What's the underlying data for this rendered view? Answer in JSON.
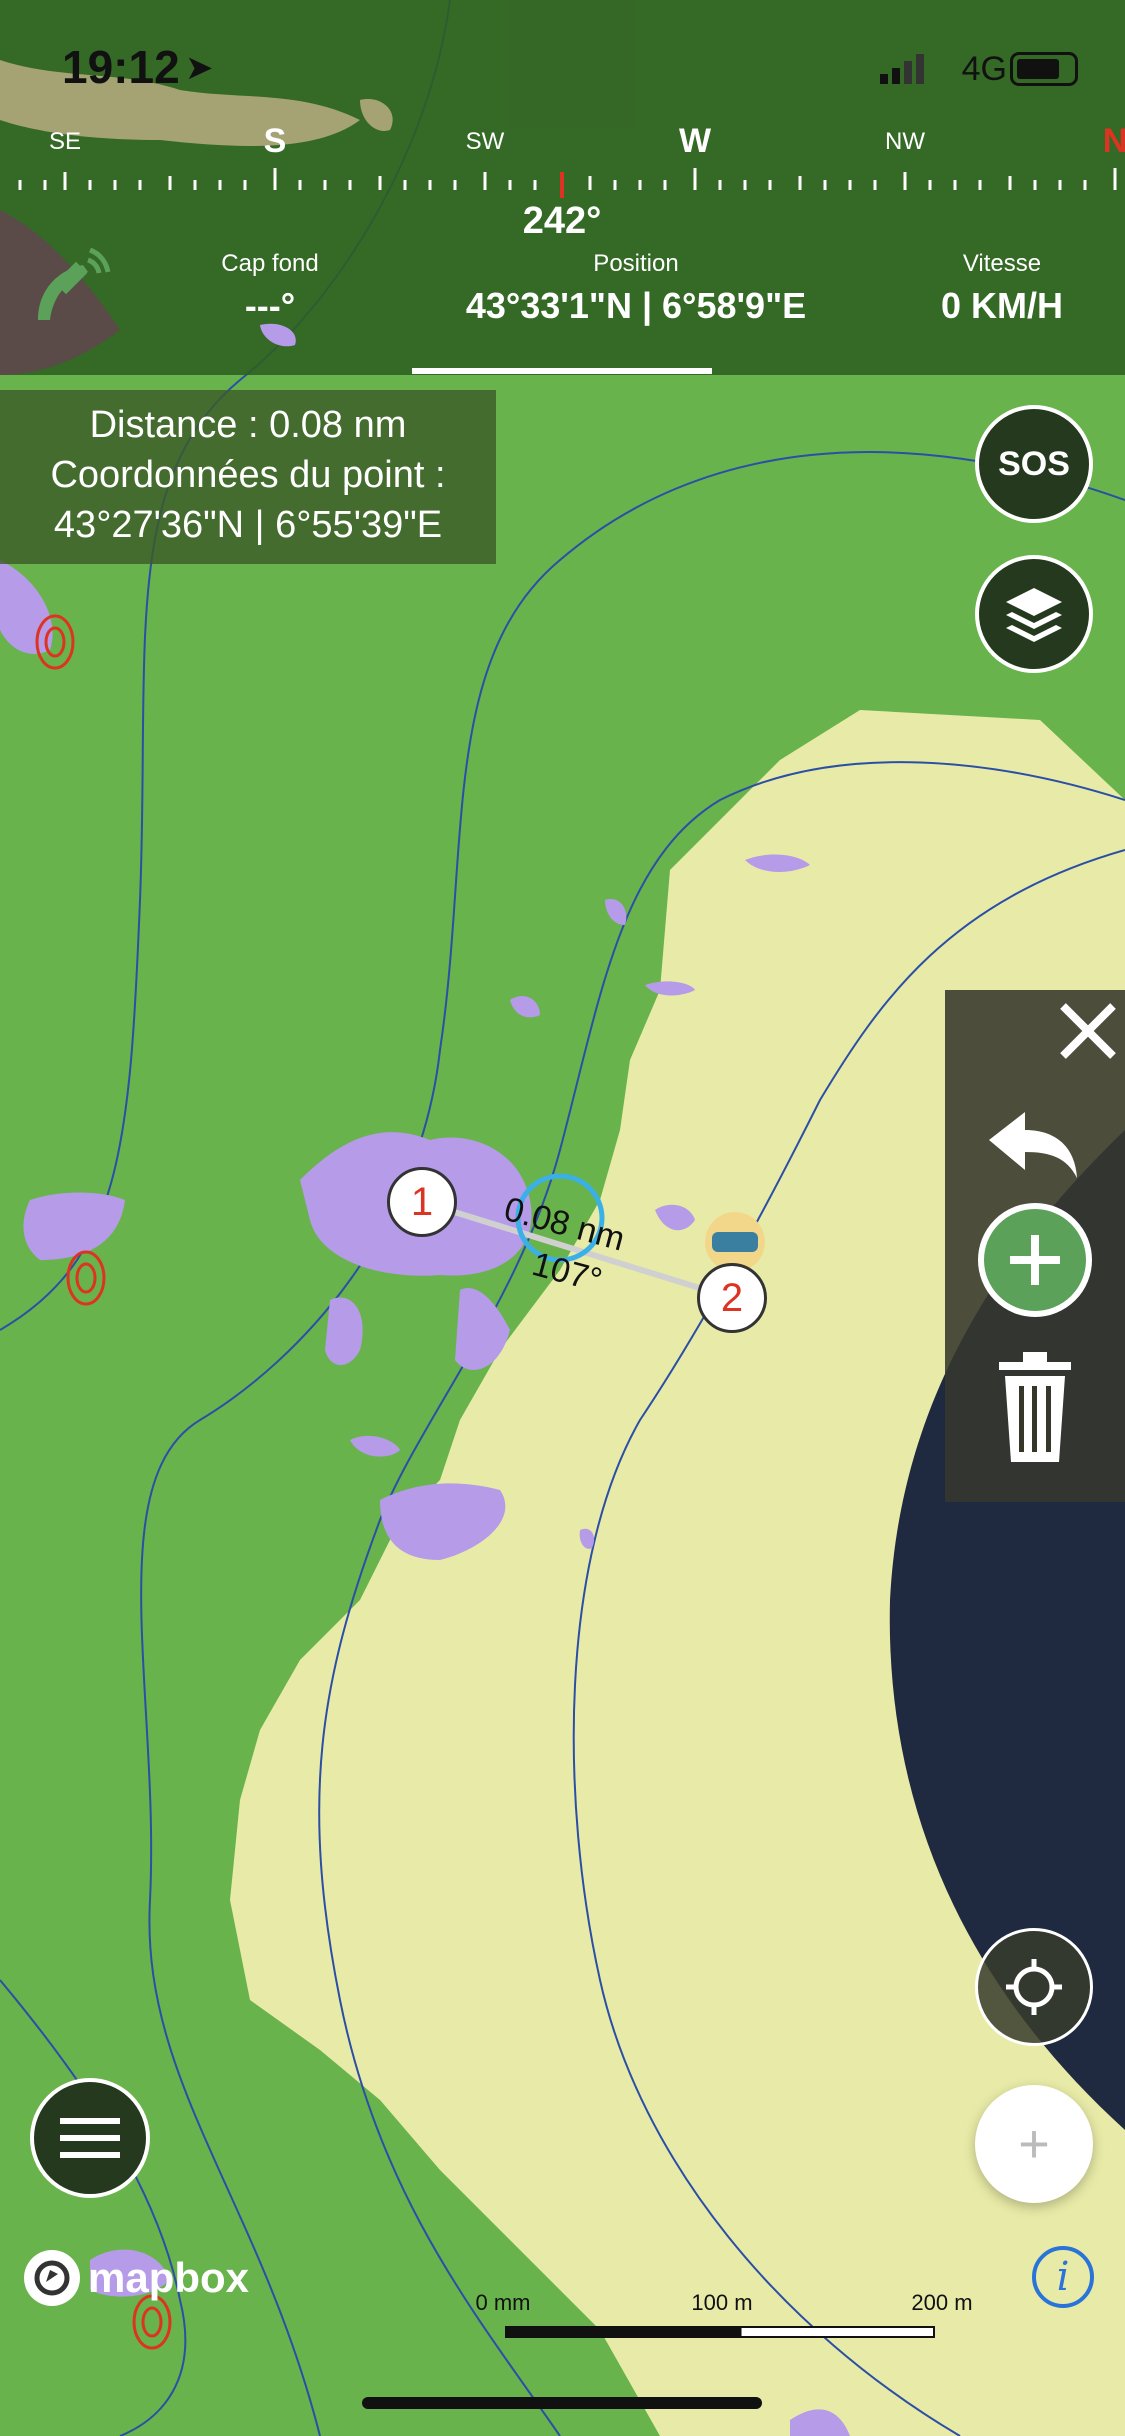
{
  "status": {
    "time": "19:12",
    "network": "4G"
  },
  "compass": {
    "labels": [
      "SE",
      "S",
      "SW",
      "W",
      "NW",
      "N"
    ],
    "heading": "242°"
  },
  "stats": {
    "cap_fond_label": "Cap fond",
    "cap_fond_value": "---°",
    "position_label": "Position",
    "position_value": "43°33'1\"N | 6°58'9\"E",
    "vitesse_label": "Vitesse",
    "vitesse_value": "0 KM/H"
  },
  "info_box": {
    "distance": "Distance : 0.08 nm",
    "coords_label": "Coordonnées du point :",
    "coords_value": "43°27'36\"N | 6°55'39\"E"
  },
  "buttons": {
    "sos": "SOS",
    "zoom_plus": "+"
  },
  "measure": {
    "wp1": "1",
    "wp2": "2",
    "distance": "0.08 nm",
    "bearing": "107°"
  },
  "attribution": {
    "logo": "mapbox"
  },
  "scale": {
    "label0": "0 mm",
    "label1": "100 m",
    "label2": "200 m"
  },
  "colors": {
    "land": "#e8eba7",
    "shallow": "#69b34c",
    "rock": "#b59be8",
    "header": "#2e5e21",
    "accent_red": "#d32"
  }
}
